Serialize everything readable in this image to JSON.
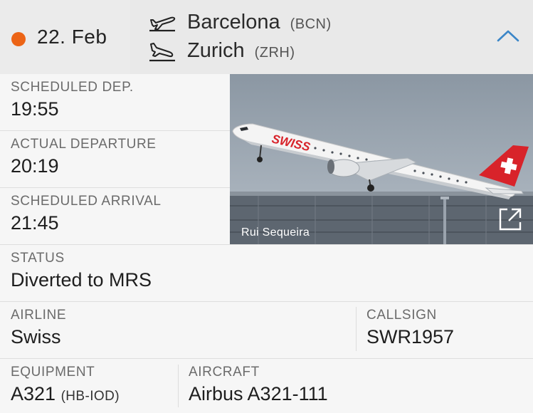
{
  "header": {
    "date": "22. Feb",
    "status_color": "#ec6416",
    "departure": {
      "city": "Barcelona",
      "code": "(BCN)",
      "icon": "takeoff-icon"
    },
    "arrival": {
      "city": "Zurich",
      "code": "(ZRH)",
      "icon": "landing-icon"
    },
    "toggle_icon": "chevron-up-icon",
    "accent": "#3b86c8"
  },
  "fields": {
    "scheduled_dep": {
      "label": "SCHEDULED DEP.",
      "value": "19:55"
    },
    "actual_dep": {
      "label": "ACTUAL DEPARTURE",
      "value": "20:19"
    },
    "scheduled_arr": {
      "label": "SCHEDULED ARRIVAL",
      "value": "21:45"
    },
    "status": {
      "label": "STATUS",
      "value": "Diverted to MRS"
    },
    "airline": {
      "label": "AIRLINE",
      "value": "Swiss"
    },
    "callsign": {
      "label": "CALLSIGN",
      "value": "SWR1957"
    },
    "equipment": {
      "label": "EQUIPMENT",
      "value": "A321",
      "registration": "(HB-IOD)"
    },
    "aircraft": {
      "label": "AIRCRAFT",
      "value": "Airbus A321-111"
    }
  },
  "photo": {
    "credit": "Rui Sequeira",
    "livery_text": "SWISS",
    "open_icon": "external-link-icon"
  }
}
